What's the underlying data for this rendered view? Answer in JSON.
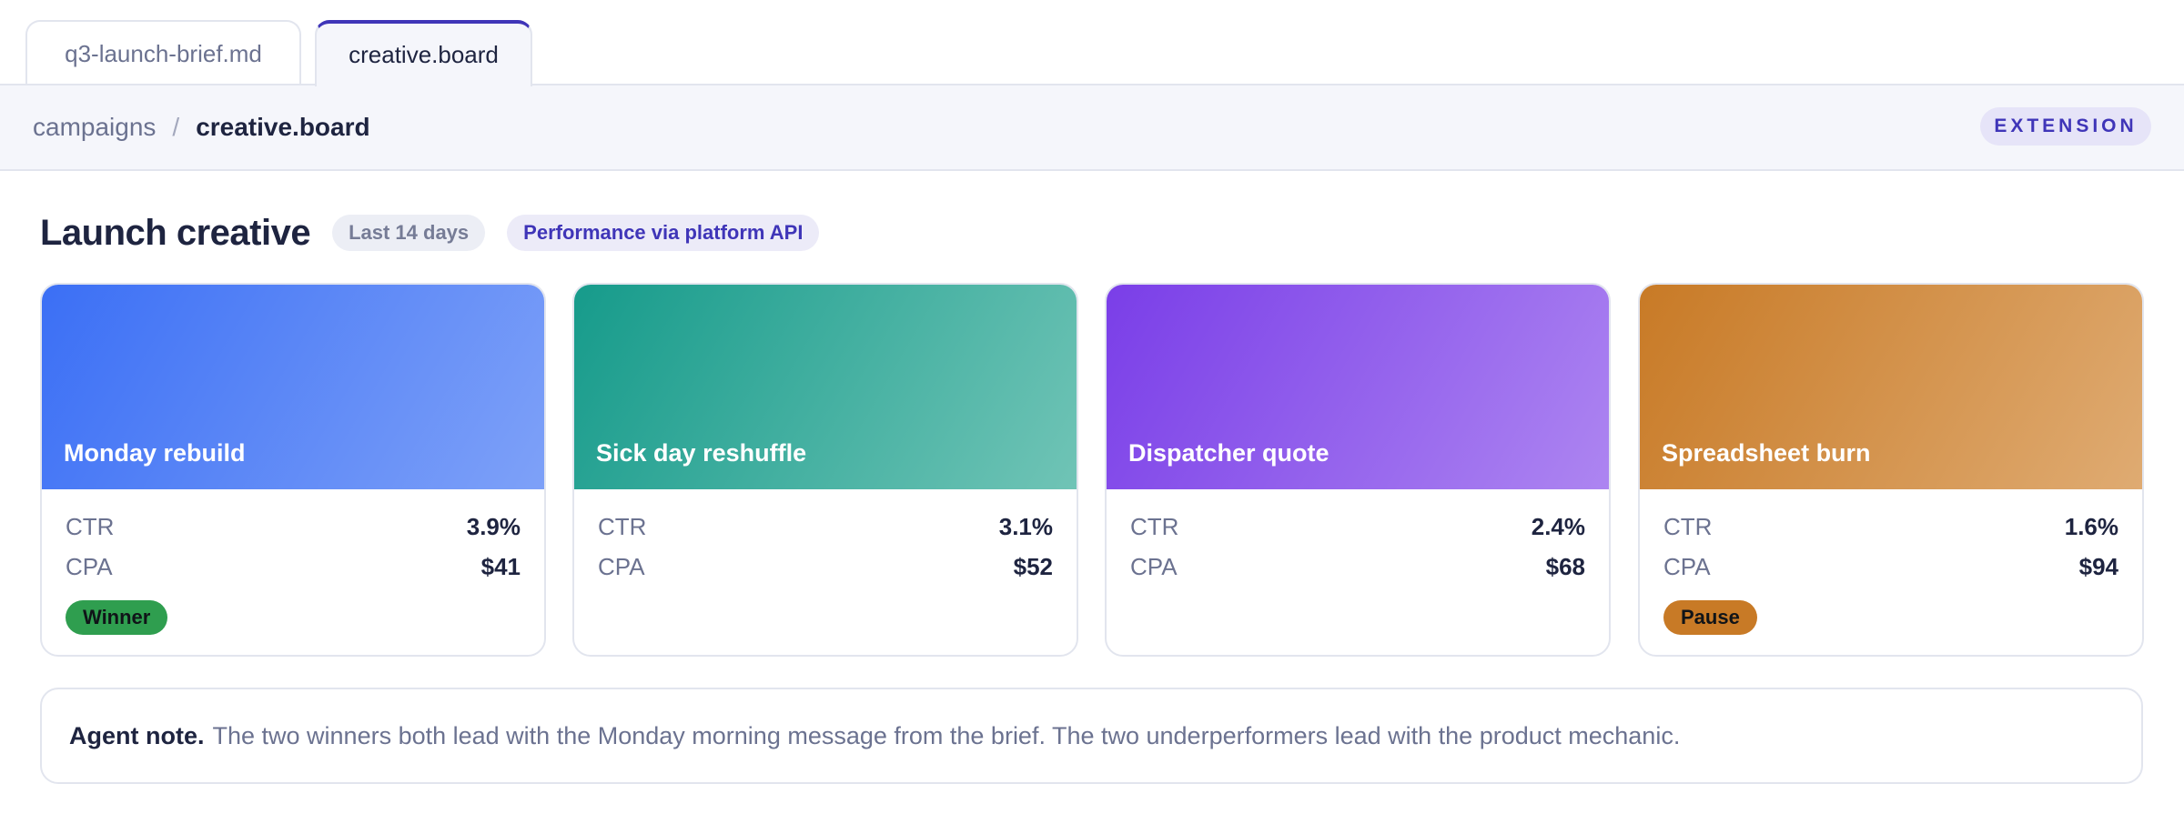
{
  "tabs": [
    {
      "label": "q3-launch-brief.md",
      "active": false
    },
    {
      "label": "creative.board",
      "active": true
    }
  ],
  "breadcrumb": {
    "root": "campaigns",
    "separator": "/",
    "current": "creative.board"
  },
  "extension_badge": "EXTENSION",
  "header": {
    "title": "Launch creative",
    "range_pill": "Last 14 days",
    "source_pill": "Performance via platform API"
  },
  "cards": [
    {
      "name": "Monday rebuild",
      "ctr_label": "CTR",
      "ctr": "3.9%",
      "cpa_label": "CPA",
      "cpa": "$41",
      "badge": "Winner",
      "gradient_from": "#3b6ff5",
      "gradient_to": "#7ea1f8",
      "badge_color": "#2f9e4f"
    },
    {
      "name": "Sick day reshuffle",
      "ctr_label": "CTR",
      "ctr": "3.1%",
      "cpa_label": "CPA",
      "cpa": "$52",
      "badge": "",
      "gradient_from": "#169b8b",
      "gradient_to": "#70c4b6",
      "badge_color": ""
    },
    {
      "name": "Dispatcher quote",
      "ctr_label": "CTR",
      "ctr": "2.4%",
      "cpa_label": "CPA",
      "cpa": "$68",
      "badge": "",
      "gradient_from": "#7a3ee8",
      "gradient_to": "#ad85f1",
      "badge_color": ""
    },
    {
      "name": "Spreadsheet burn",
      "ctr_label": "CTR",
      "ctr": "1.6%",
      "cpa_label": "CPA",
      "cpa": "$94",
      "badge": "Pause",
      "gradient_from": "#c87a26",
      "gradient_to": "#dfab72",
      "badge_color": "#c87a26"
    }
  ],
  "note": {
    "lead": "Agent note.",
    "text": "The two winners both lead with the Monday morning message from the brief. The two underperformers lead with the product mechanic."
  }
}
